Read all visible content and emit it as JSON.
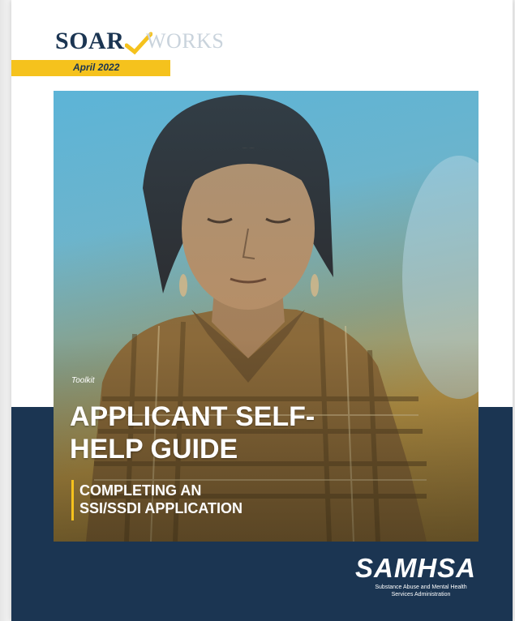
{
  "logo": {
    "soar": "OAR",
    "soar_initial": "S",
    "works": "WORKS",
    "date": "April 2022"
  },
  "cover": {
    "kicker": "Toolkit",
    "title_line1": "APPLICANT SELF-",
    "title_line2": "HELP GUIDE",
    "subtitle_line1": "COMPLETING AN",
    "subtitle_line2": "SSI/SSDI APPLICATION"
  },
  "publisher": {
    "name": "SAMHSA",
    "full_line1": "Substance Abuse and Mental Health",
    "full_line2": "Services Administration"
  },
  "colors": {
    "navy": "#1b3552",
    "accent_yellow": "#f5c21d"
  }
}
